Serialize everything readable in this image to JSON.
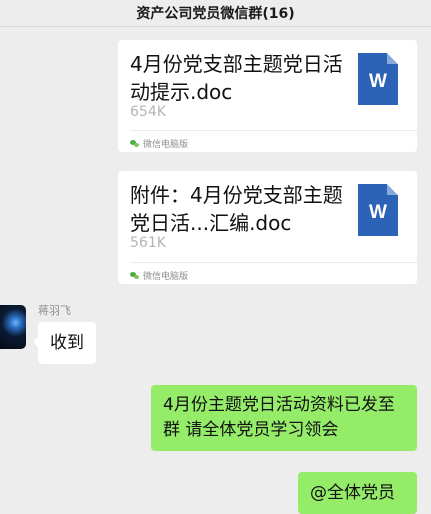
{
  "header": {
    "title": "资产公司党员微信群(16)"
  },
  "messages": [
    {
      "type": "file",
      "title": "4月份党支部主题党日活动提示.doc",
      "size": "654K",
      "file_icon": "word-document-icon",
      "file_icon_letter": "W",
      "source": "微信电脑版"
    },
    {
      "type": "file",
      "title": "附件：4月份党支部主题党日活...汇编.doc",
      "size": "561K",
      "file_icon": "word-document-icon",
      "file_icon_letter": "W",
      "source": "微信电脑版"
    },
    {
      "type": "text",
      "direction": "incoming",
      "sender": "蒋羽飞",
      "text": "收到"
    },
    {
      "type": "text",
      "direction": "outgoing",
      "text": "4月份主题党日活动资料已发至群 请全体党员学习领会"
    },
    {
      "type": "text",
      "direction": "outgoing",
      "text": "@全体党员"
    }
  ],
  "colors": {
    "background": "#ededed",
    "outgoing_bubble": "#95ec69",
    "incoming_bubble": "#ffffff",
    "word_icon": "#2d63b7"
  }
}
